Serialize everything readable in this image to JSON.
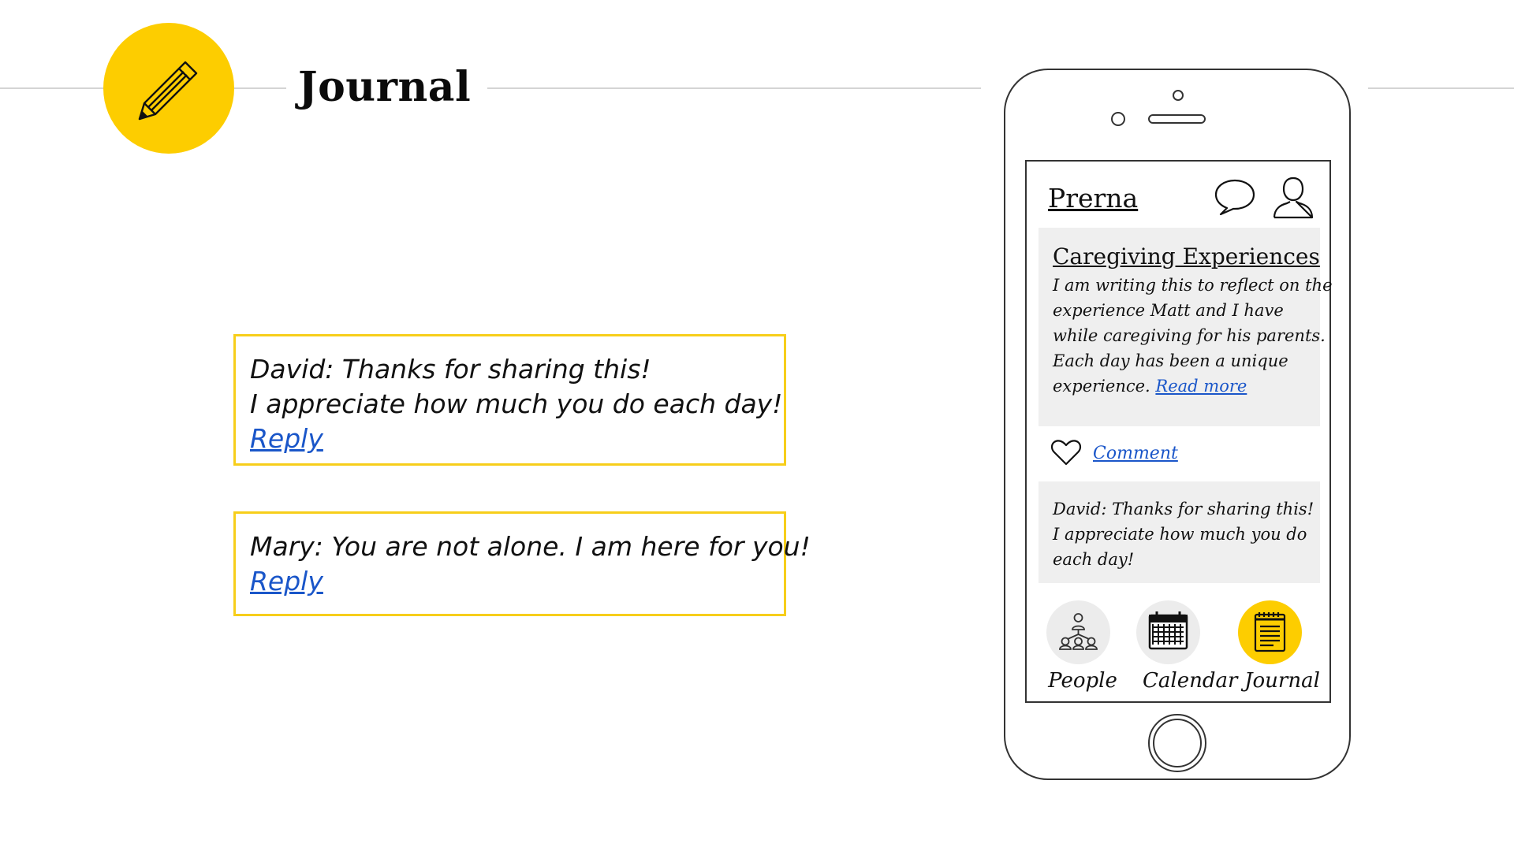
{
  "header": {
    "title": "Journal"
  },
  "comments": [
    {
      "lines": [
        "David: Thanks for sharing this!",
        "I appreciate how much you do each day!"
      ],
      "reply_label": "Reply"
    },
    {
      "lines": [
        "Mary: You are not alone. I am here for you!"
      ],
      "reply_label": "Reply"
    }
  ],
  "phone": {
    "app_title": "Prerna",
    "post": {
      "title": "Caregiving Experiences",
      "body_lines": [
        "I am writing this to reflect on the",
        "experience Matt and I have",
        "while caregiving for his parents.",
        "Each day has been a unique",
        "experience."
      ],
      "read_more": "Read more"
    },
    "comment_label": "Comment",
    "preview_lines": [
      "David: Thanks for sharing this!",
      "I appreciate how much you do",
      "each day!"
    ],
    "nav": [
      {
        "label": "People",
        "icon": "people-icon",
        "active": false
      },
      {
        "label": "Calendar",
        "icon": "calendar-icon",
        "active": false
      },
      {
        "label": "Journal",
        "icon": "notepad-icon",
        "active": true
      }
    ]
  },
  "colors": {
    "accent": "#fdcd00",
    "box_border": "#f7ce1a",
    "link": "#1a56c9",
    "card_bg": "#efefef",
    "nav_inactive": "#ececec"
  }
}
